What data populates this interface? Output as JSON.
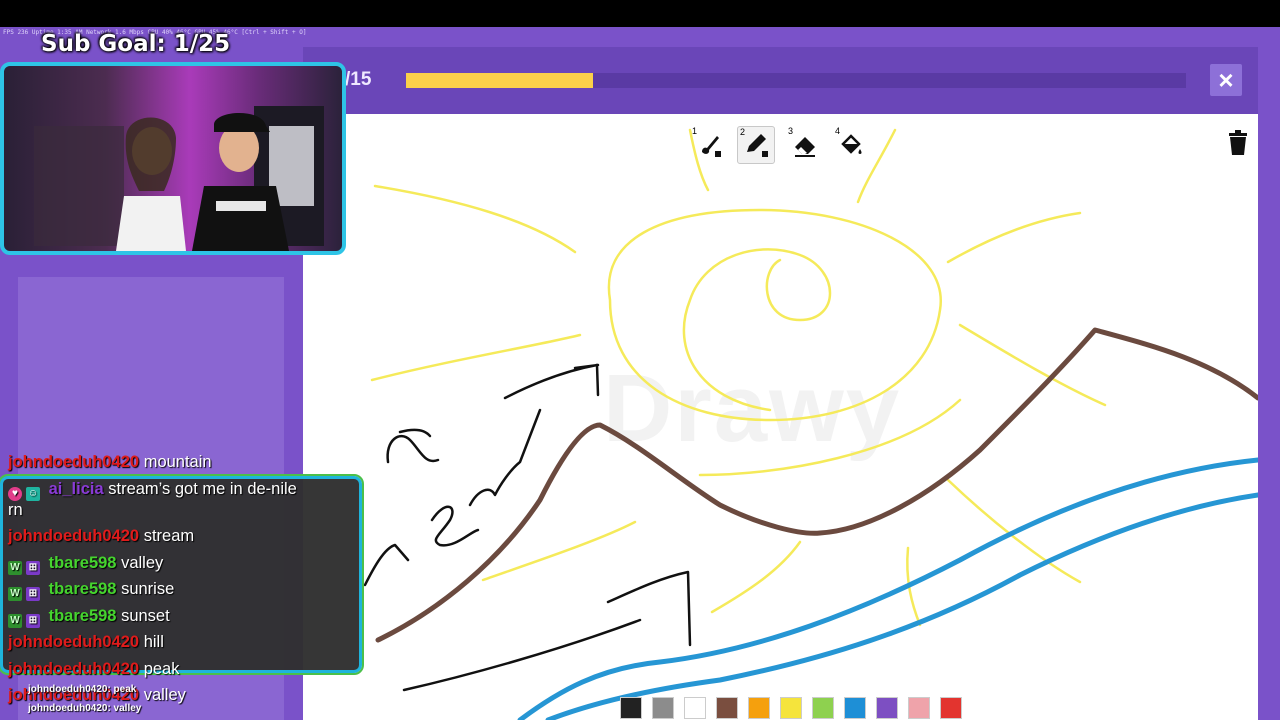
{
  "stream": {
    "sysstats": "FPS 236   Uptime 1:35 AM   Network 1.6 Mbps   CPU 40% 46°C   GPU 45% 46°C   [Ctrl + Shift + O]",
    "sub_goal": "Sub Goal: 1/25"
  },
  "game": {
    "round_label": "/15",
    "progress": 0.24,
    "close_label": "×",
    "watermark": "Drawy",
    "tools": [
      {
        "num": "1",
        "name": "brush"
      },
      {
        "num": "2",
        "name": "pencil"
      },
      {
        "num": "3",
        "name": "eraser"
      },
      {
        "num": "4",
        "name": "fill"
      }
    ],
    "selected_tool": "2",
    "palette": [
      "#222222",
      "#8c8c8c",
      "#ffffff",
      "#7a4e3f",
      "#f5a00d",
      "#f5e43c",
      "#8ed14f",
      "#1e8fd6",
      "#7d4fc2",
      "#efa3aa",
      "#e3342f"
    ],
    "stroke_colors": {
      "sun": "#f5ea5a",
      "mountain": "#6b4a3f",
      "river": "#2696d4",
      "ink": "#111111"
    }
  },
  "chat": {
    "messages": [
      {
        "user": "johndoeduh0420",
        "text": "mountain",
        "color": "#e01b1b"
      },
      {
        "user": "ai_licia",
        "text": "stream’s got me in de-nile",
        "cont": "rn",
        "color": "#8a3bd6"
      },
      {
        "user": "johndoeduh0420",
        "text": "stream",
        "color": "#e01b1b"
      },
      {
        "user": "tbare598",
        "text": "valley",
        "color": "#45d42e"
      },
      {
        "user": "tbare598",
        "text": "sunrise",
        "color": "#45d42e"
      },
      {
        "user": "tbare598",
        "text": "sunset",
        "color": "#45d42e"
      },
      {
        "user": "johndoeduh0420",
        "text": "hill",
        "color": "#e01b1b"
      },
      {
        "user": "johndoeduh0420",
        "text": "peak",
        "color": "#e01b1b"
      },
      {
        "user": "johndoeduh0420",
        "text": "valley",
        "color": "#e01b1b"
      }
    ],
    "overlay_lines": [
      "johndoeduh0420: peak",
      "johndoeduh0420: valley"
    ]
  }
}
